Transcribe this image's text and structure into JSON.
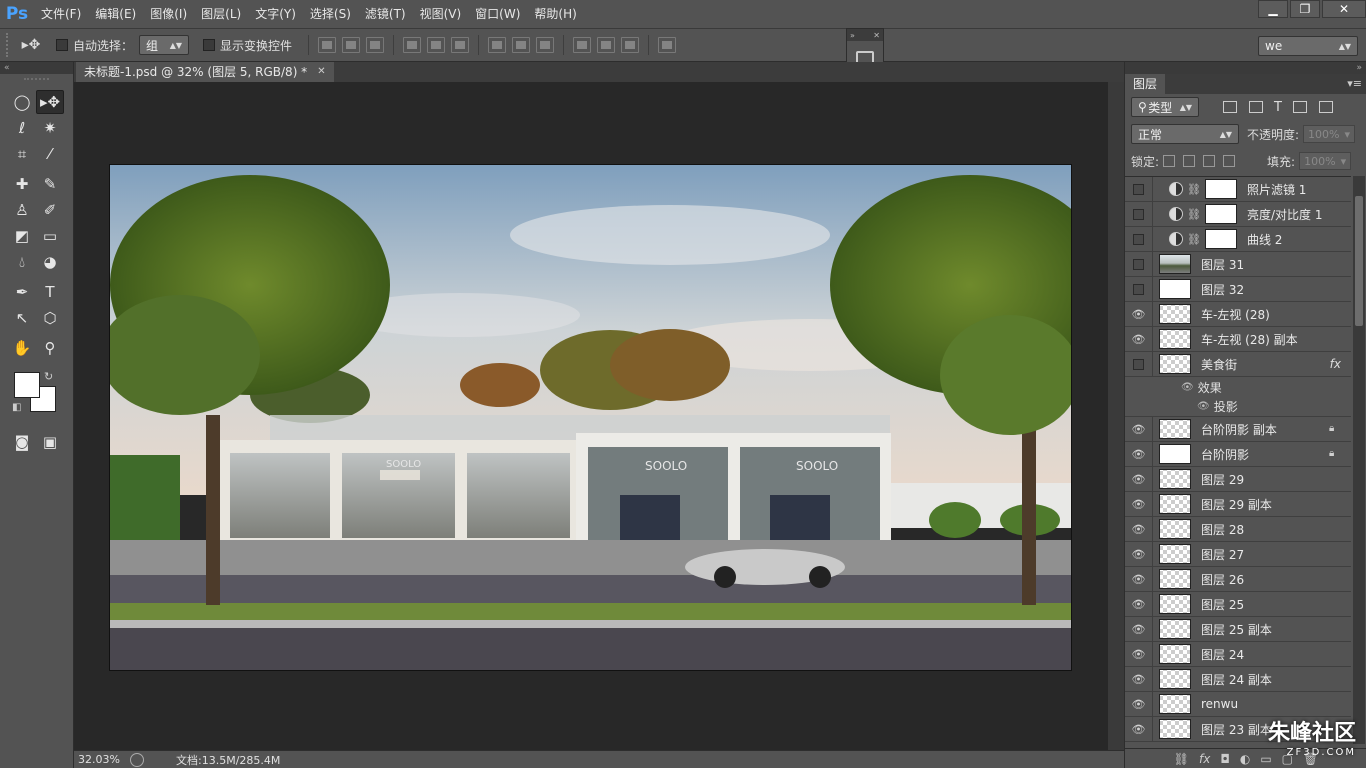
{
  "app": {
    "logo": "Ps"
  },
  "menu": [
    "文件(F)",
    "编辑(E)",
    "图像(I)",
    "图层(L)",
    "文字(Y)",
    "选择(S)",
    "滤镜(T)",
    "视图(V)",
    "窗口(W)",
    "帮助(H)"
  ],
  "options": {
    "auto_select_label": "自动选择：",
    "auto_select_value": "组",
    "show_transform_label": "显示变换控件",
    "workspace": "we"
  },
  "document": {
    "tab_title": "未标题-1.psd @ 32% (图层 5, RGB/8) *",
    "zoom": "32.03%",
    "doc_info": "文档:13.5M/285.4M"
  },
  "layers_panel": {
    "tab": "图层",
    "filter": "类型",
    "blend_mode": "正常",
    "opacity_label": "不透明度:",
    "opacity_value": "100%",
    "lock_label": "锁定:",
    "fill_label": "填充:",
    "fill_value": "100%",
    "layers": [
      {
        "name": "照片滤镜 1",
        "visible": false,
        "kind": "adjustment"
      },
      {
        "name": "亮度/对比度 1",
        "visible": false,
        "kind": "adjustment"
      },
      {
        "name": "曲线 2",
        "visible": false,
        "kind": "adjustment"
      },
      {
        "name": "图层 31",
        "visible": false,
        "kind": "photo"
      },
      {
        "name": "图层 32",
        "visible": false,
        "kind": "white"
      },
      {
        "name": "车-左视 (28)",
        "visible": true,
        "kind": "checker"
      },
      {
        "name": "车-左视 (28) 副本",
        "visible": true,
        "kind": "checker"
      },
      {
        "name": "美食街",
        "visible": false,
        "kind": "checker",
        "fx": "fx"
      },
      {
        "name": "台阶阴影 副本",
        "visible": true,
        "kind": "checker",
        "locked": true
      },
      {
        "name": "台阶阴影",
        "visible": true,
        "kind": "white",
        "locked": true
      },
      {
        "name": "图层 29",
        "visible": true,
        "kind": "checker"
      },
      {
        "name": "图层 29 副本",
        "visible": true,
        "kind": "checker"
      },
      {
        "name": "图层 28",
        "visible": true,
        "kind": "checker"
      },
      {
        "name": "图层 27",
        "visible": true,
        "kind": "checker"
      },
      {
        "name": "图层 26",
        "visible": true,
        "kind": "checker"
      },
      {
        "name": "图层 25",
        "visible": true,
        "kind": "checker"
      },
      {
        "name": "图层 25 副本",
        "visible": true,
        "kind": "checker"
      },
      {
        "name": "图层 24",
        "visible": true,
        "kind": "checker"
      },
      {
        "name": "图层 24 副本",
        "visible": true,
        "kind": "checker"
      },
      {
        "name": "renwu",
        "visible": true,
        "kind": "checker"
      },
      {
        "name": "图层 23 副本",
        "visible": true,
        "kind": "checker"
      }
    ],
    "effects_label": "效果",
    "drop_shadow_label": "投影"
  },
  "canvas_text": {
    "sign_left": "SOOLO",
    "sign_mid": "SOOLO",
    "sign_right": "SOOLO"
  },
  "watermark": {
    "main": "朱峰社区",
    "sub": "ZF3D.COM"
  }
}
